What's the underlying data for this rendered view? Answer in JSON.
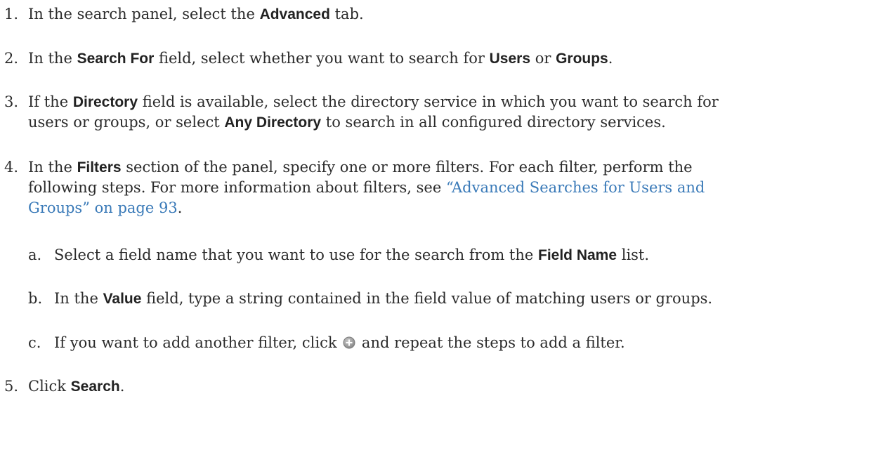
{
  "steps": [
    {
      "num": "1.",
      "t1": "In the search panel, select the ",
      "b1": "Advanced",
      "t2": " tab."
    },
    {
      "num": "2.",
      "t1": "In the ",
      "b1": "Search For",
      "t2": " field, select whether you want to search for ",
      "b2": "Users",
      "t3": " or ",
      "b3": "Groups",
      "t4": "."
    },
    {
      "num": "3.",
      "t1": "If the ",
      "b1": "Directory",
      "t2": " field is available, select the directory service in which you want to search for",
      "t3": "users or groups, or select ",
      "b2": "Any Directory",
      "t4": " to search in all configured directory services."
    },
    {
      "num": "4.",
      "t1": "In the ",
      "b1": "Filters",
      "t2": " section of the panel, specify one or more filters. For each filter, perform the",
      "t3": "following steps. For more information about filters, see ",
      "link1": "“Advanced Searches for Users and",
      "link2": "Groups” on page 93",
      "t4": "."
    },
    {
      "num": "5.",
      "t1": "Click ",
      "b1": "Search",
      "t2": "."
    }
  ],
  "substeps": [
    {
      "num": "a.",
      "t1": "Select a field name that you want to use for the search from the ",
      "b1": "Field Name",
      "t2": " list."
    },
    {
      "num": "b.",
      "t1": "In the ",
      "b1": "Value",
      "t2": " field, type a string contained in the field value of matching users or groups."
    },
    {
      "num": "c.",
      "t1": "If you want to add another filter, click ",
      "icon": "add-circle-icon",
      "t2": " and repeat the steps to add a filter."
    }
  ]
}
